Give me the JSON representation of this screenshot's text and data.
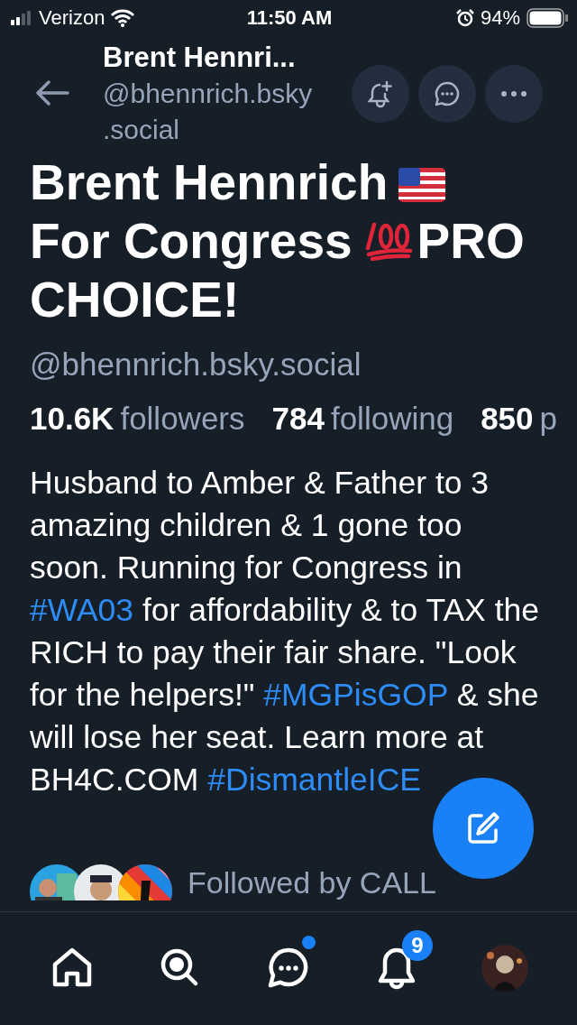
{
  "status_bar": {
    "carrier": "Verizon",
    "time": "11:50 AM",
    "battery": "94%"
  },
  "header": {
    "name": "Brent Hennri...",
    "handle": "@bhennrich.bsky .social"
  },
  "title_lines": [
    [
      {
        "kind": "text",
        "text": "Brent Hennrich"
      },
      {
        "kind": "flag"
      }
    ],
    [
      {
        "kind": "text",
        "text": "For Congress"
      },
      {
        "kind": "hundred"
      },
      {
        "kind": "text",
        "text": "PRO"
      }
    ],
    [
      {
        "kind": "text",
        "text": "CHOICE!"
      }
    ]
  ],
  "handle": "@bhennrich.bsky.social",
  "stats": [
    {
      "count": "10.6K",
      "label": "followers"
    },
    {
      "count": "784",
      "label": "following"
    },
    {
      "count": "850",
      "label": "p"
    }
  ],
  "bio": [
    {
      "kind": "text",
      "text": "Husband to Amber & Father to 3 amazing children & 1 gone too soon. Running for Congress in "
    },
    {
      "kind": "hashtag",
      "text": "#WA03"
    },
    {
      "kind": "text",
      "text": " for affordability & to TAX the RICH to pay their fair share. \"Look for the helpers!\" "
    },
    {
      "kind": "hashtag",
      "text": "#MGPisGOP"
    },
    {
      "kind": "text",
      "text": " & she will lose her seat. Learn more at BH4C.COM "
    },
    {
      "kind": "hashtag",
      "text": "#DismantleICE"
    }
  ],
  "followed_by": "Followed by CALL",
  "nav": [
    {
      "kind": "home",
      "dot": false
    },
    {
      "kind": "search",
      "dot": false
    },
    {
      "kind": "chat",
      "dot": true
    },
    {
      "kind": "bell",
      "dot": false,
      "badge": "9"
    },
    {
      "kind": "avatar",
      "dot": false
    }
  ]
}
